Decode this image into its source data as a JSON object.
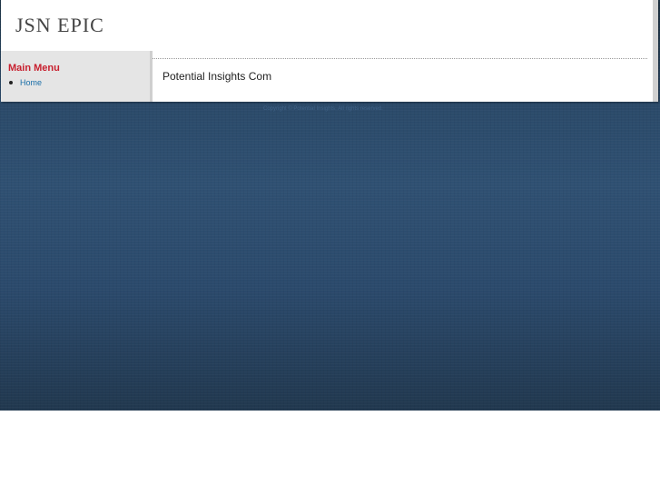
{
  "site": {
    "logo_text": "JSN EPIC"
  },
  "sidebar": {
    "menu_title": "Main Menu",
    "items": [
      {
        "label": "Home"
      }
    ]
  },
  "content": {
    "article_title": "Potential Insights Com"
  },
  "footer": {
    "text": "Copyright © Potential Insights. All rights reserved."
  },
  "colors": {
    "menu_title": "#c8202f",
    "link": "#1b6fa8",
    "backdrop": "#2f5072"
  }
}
